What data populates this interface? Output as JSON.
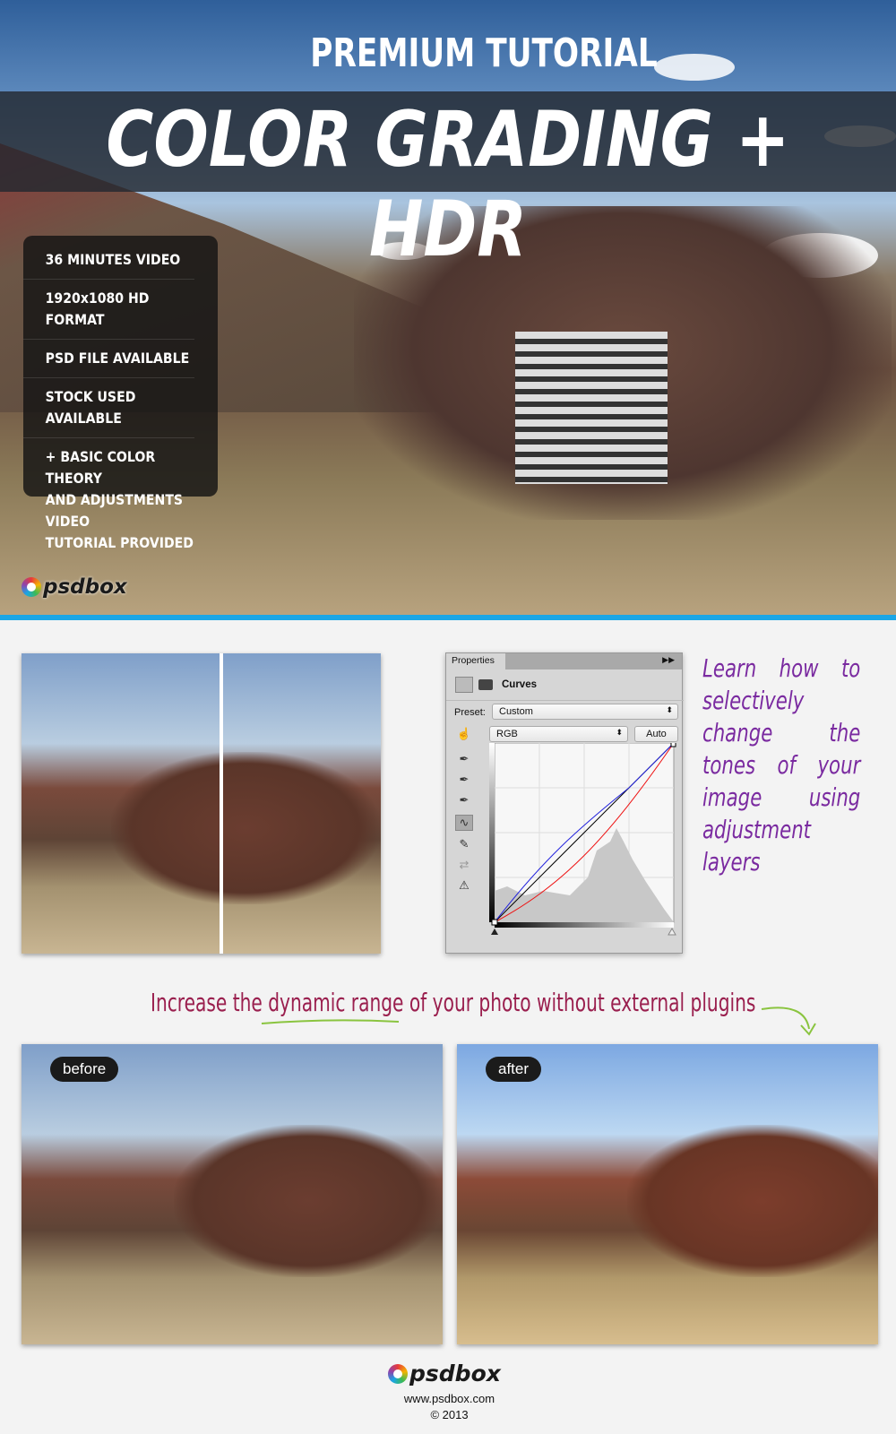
{
  "hero": {
    "kicker": "PREMIUM TUTORIAL",
    "title": "COLOR GRADING + HDR",
    "features": [
      "36 MINUTES VIDEO",
      "1920x1080 HD FORMAT",
      "PSD FILE AVAILABLE",
      "STOCK USED AVAILABLE",
      "+ BASIC COLOR THEORY\nAND ADJUSTMENTS VIDEO\nTUTORIAL PROVIDED"
    ],
    "logo": "psdbox"
  },
  "accent_color": "#1aa6e6",
  "properties_panel": {
    "tab": "Properties",
    "expand_icon": "double-chevron-right-icon",
    "adjustment": "Curves",
    "preset_label": "Preset:",
    "preset_value": "Custom",
    "channel": "RGB",
    "auto_label": "Auto",
    "tools": [
      "on-image-adjust-icon",
      "black-eyedropper-icon",
      "gray-eyedropper-icon",
      "white-eyedropper-icon",
      "curve-points-icon",
      "pencil-icon",
      "smooth-icon",
      "clipping-warning-icon"
    ]
  },
  "blurb": "Learn how to selectively change the tones of your image using adjustment layers",
  "caption": "Increase the dynamic range of your photo without external plugins",
  "before_label": "before",
  "after_label": "after",
  "footer": {
    "logo": "psdbox",
    "url": "www.psdbox.com",
    "copyright": "© 2013"
  }
}
